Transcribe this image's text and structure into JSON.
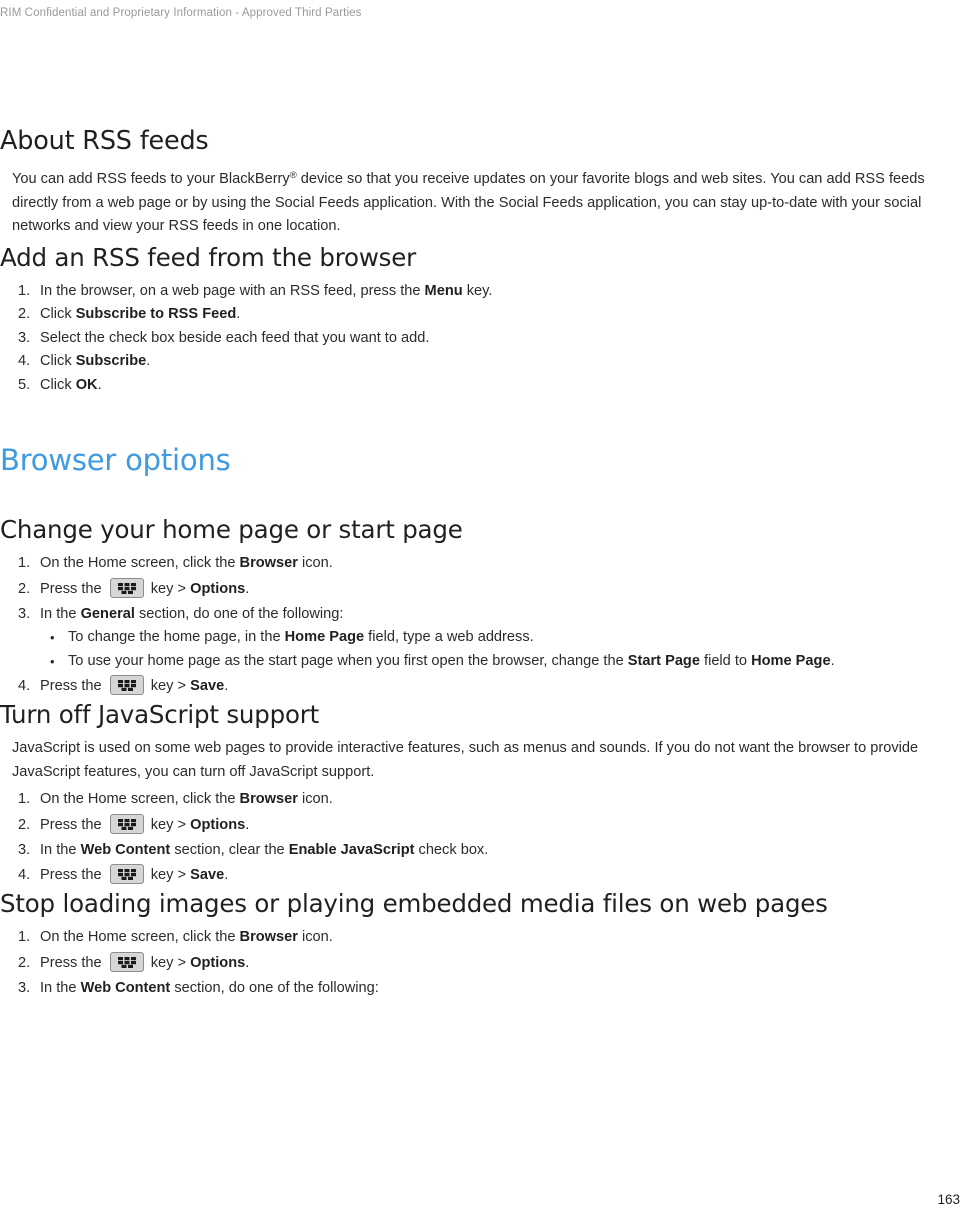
{
  "header": {
    "confidentiality_notice": "RIM Confidential and Proprietary Information - Approved Third Parties"
  },
  "footer": {
    "page_number": "163"
  },
  "colors": {
    "chapter_heading": "#3f9ae0",
    "body_text": "#2d2a2b",
    "header_text": "#9a9a9a",
    "menu_key_fill": "#d6d6d6",
    "menu_key_border": "#8c8c8c"
  },
  "sections": {
    "about_rss": {
      "title": "About RSS feeds",
      "paragraph": "You can add RSS feeds to your BlackBerry® device so that you receive updates on your favorite blogs and web sites. You can add RSS feeds directly from a web page or by using the Social Feeds application. With the Social Feeds application, you can stay up-to-date with your social networks and view your RSS feeds in one location."
    },
    "add_rss_feed": {
      "title": "Add an RSS feed from the browser",
      "steps": [
        {
          "prefix": "In the browser, on a web page with an RSS feed, press the ",
          "bold": "Menu",
          "suffix": " key."
        },
        {
          "prefix": "Click ",
          "bold": "Subscribe to RSS Feed",
          "suffix": "."
        },
        {
          "prefix": "Select the check box beside each feed that you want to add.",
          "bold": "",
          "suffix": ""
        },
        {
          "prefix": "Click ",
          "bold": "Subscribe",
          "suffix": "."
        },
        {
          "prefix": "Click ",
          "bold": "OK",
          "suffix": "."
        }
      ]
    },
    "browser_options": {
      "title": "Browser options"
    },
    "change_home_page": {
      "title": "Change your home page or start page",
      "step1": {
        "prefix": "On the Home screen, click the ",
        "bold": "Browser",
        "suffix": " icon."
      },
      "step2": {
        "prefix": "Press the ",
        "key_icon": "blackberry-menu-key",
        "middle": " key > ",
        "bold": "Options",
        "suffix": "."
      },
      "step3": {
        "prefix": "In the ",
        "bold": "General",
        "suffix": " section, do one of the following:"
      },
      "substeps": [
        {
          "prefix": "To change the home page, in the ",
          "bold": "Home Page",
          "suffix": " field, type a web address."
        },
        {
          "prefix": "To use your home page as the start page when you first open the browser, change the ",
          "bold": "Start Page",
          "middle": " field to ",
          "bold2": "Home Page",
          "suffix": "."
        }
      ],
      "step4": {
        "prefix": "Press the ",
        "key_icon": "blackberry-menu-key",
        "middle": " key > ",
        "bold": "Save",
        "suffix": "."
      }
    },
    "turn_off_javascript": {
      "title": "Turn off JavaScript support",
      "paragraph": "JavaScript is used on some web pages to provide interactive features, such as menus and sounds. If you do not want the browser to provide JavaScript features, you can turn off JavaScript support.",
      "step1": {
        "prefix": "On the Home screen, click the ",
        "bold": "Browser",
        "suffix": " icon."
      },
      "step2": {
        "prefix": "Press the ",
        "key_icon": "blackberry-menu-key",
        "middle": " key > ",
        "bold": "Options",
        "suffix": "."
      },
      "step3": {
        "prefix": "In the ",
        "bold": "Web Content",
        "middle": " section, clear the ",
        "bold2": "Enable JavaScript",
        "suffix": " check box."
      },
      "step4": {
        "prefix": "Press the ",
        "key_icon": "blackberry-menu-key",
        "middle": " key > ",
        "bold": "Save",
        "suffix": "."
      }
    },
    "stop_loading_images": {
      "title": "Stop loading images or playing embedded media files on web pages",
      "step1": {
        "prefix": "On the Home screen, click the ",
        "bold": "Browser",
        "suffix": " icon."
      },
      "step2": {
        "prefix": "Press the ",
        "key_icon": "blackberry-menu-key",
        "middle": " key > ",
        "bold": "Options",
        "suffix": "."
      },
      "step3": {
        "prefix": "In the ",
        "bold": "Web Content",
        "suffix": " section, do one of the following:"
      }
    }
  }
}
